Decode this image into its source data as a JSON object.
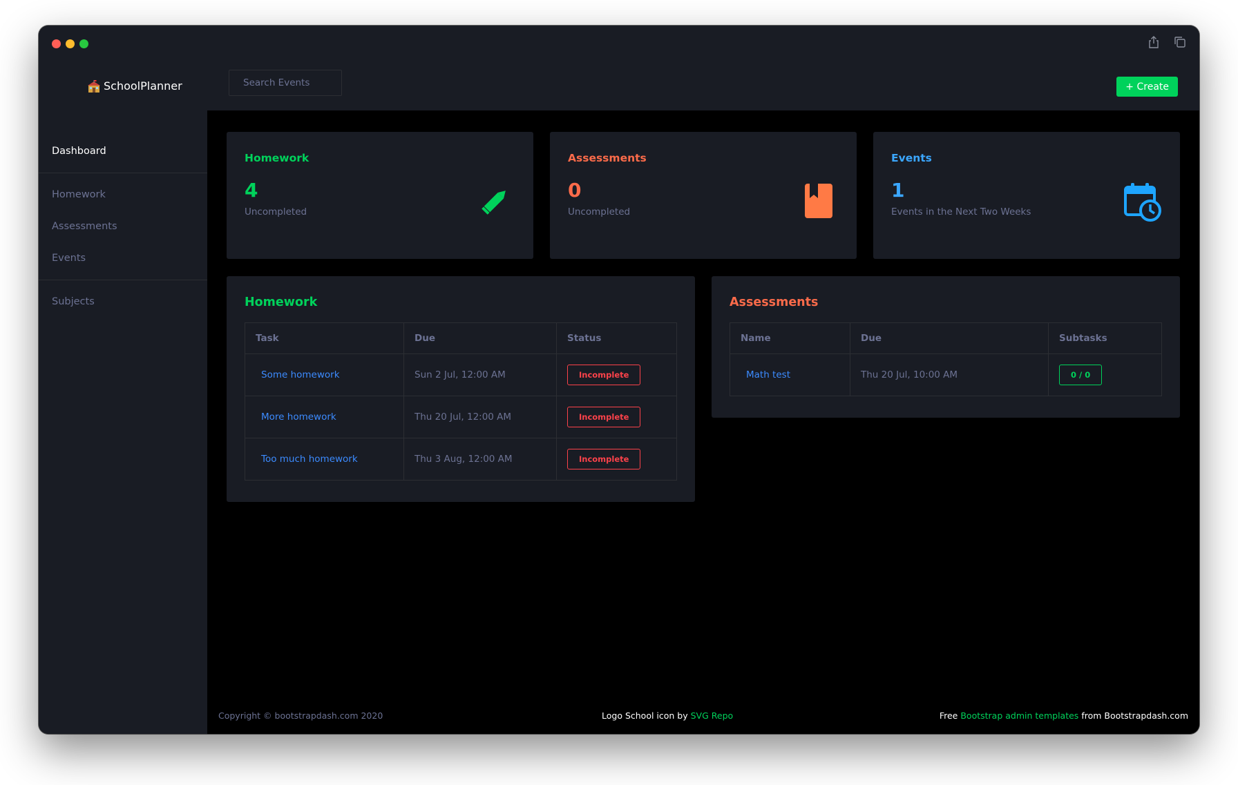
{
  "window": {
    "controls": [
      "close",
      "minimize",
      "zoom"
    ],
    "toolbar_icons": [
      "share-icon",
      "copy-icon"
    ]
  },
  "navbar": {
    "brand": "SchoolPlanner",
    "search_placeholder": "Search Events",
    "create_label": "+ Create"
  },
  "sidebar": {
    "dashboard": "Dashboard",
    "items": [
      "Homework",
      "Assessments",
      "Events"
    ],
    "subjects": "Subjects"
  },
  "stats": {
    "homework": {
      "title": "Homework",
      "count": "4",
      "subtitle": "Uncompleted",
      "icon": "pencil-icon",
      "color": "#00d25b"
    },
    "assessments": {
      "title": "Assessments",
      "count": "0",
      "subtitle": "Uncompleted",
      "icon": "book-icon",
      "color": "#fc424a"
    },
    "events": {
      "title": "Events",
      "count": "1",
      "subtitle": "Events in the Next Two Weeks",
      "icon": "calendar-clock-icon",
      "color": "#3ba7ff"
    }
  },
  "homework_table": {
    "title": "Homework",
    "headers": [
      "Task",
      "Due",
      "Status"
    ],
    "rows": [
      {
        "task": "Some homework",
        "due": "Sun 2 Jul, 12:00 AM",
        "status": "Incomplete"
      },
      {
        "task": "More homework",
        "due": "Thu 20 Jul, 12:00 AM",
        "status": "Incomplete"
      },
      {
        "task": "Too much homework",
        "due": "Thu 3 Aug, 12:00 AM",
        "status": "Incomplete"
      }
    ]
  },
  "assessments_table": {
    "title": "Assessments",
    "headers": [
      "Name",
      "Due",
      "Subtasks"
    ],
    "rows": [
      {
        "name": "Math test",
        "due": "Thu 20 Jul, 10:00 AM",
        "subtasks": "0 / 0"
      }
    ]
  },
  "footer": {
    "copyright": "Copyright © bootstrapdash.com 2020",
    "logo_credit_text": "Logo School icon by",
    "logo_credit_link": "SVG Repo",
    "right_prefix": "Free",
    "right_link": "Bootstrap admin templates",
    "right_suffix": "from Bootstrapdash.com"
  },
  "colors": {
    "background": "#000000",
    "panel": "#191c24",
    "muted": "#6c7293",
    "success": "#00d25b",
    "danger": "#fc424a",
    "primary": "#3c8bff"
  }
}
